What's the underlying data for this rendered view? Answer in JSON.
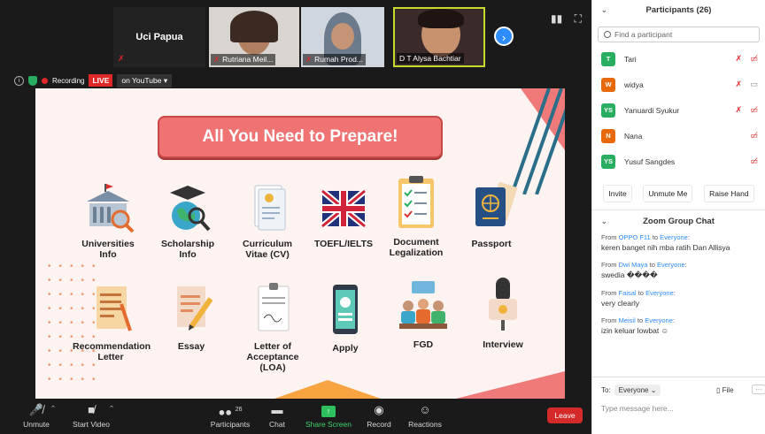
{
  "video_strip": {
    "tiles": [
      {
        "name": "Uci Papua",
        "type": "name-only"
      },
      {
        "name": "Rutriana Meil...",
        "mic": "muted"
      },
      {
        "name": "Rumah Prod...",
        "mic": "muted"
      },
      {
        "name": "D T Alysa Bachtiar",
        "mic": "on"
      }
    ]
  },
  "recording": {
    "label": "Recording",
    "live_badge": "LIVE",
    "stream": "on YouTube"
  },
  "slide": {
    "title": "All You Need to Prepare!",
    "items": [
      {
        "label1": "Universities",
        "label2": "Info",
        "icon": "university-icon"
      },
      {
        "label1": "Scholarship",
        "label2": "Info",
        "icon": "scholarship-globe-icon"
      },
      {
        "label1": "Curriculum",
        "label2": "Vitae (CV)",
        "icon": "cv-document-icon"
      },
      {
        "label1": "TOEFL/IELTS",
        "label2": "",
        "icon": "uk-flag-icon"
      },
      {
        "label1": "Document",
        "label2": "Legalization",
        "icon": "clipboard-checklist-icon"
      },
      {
        "label1": "Passport",
        "label2": "",
        "icon": "passport-icon"
      },
      {
        "label1": "Recommendation",
        "label2": "Letter",
        "icon": "recommendation-letter-icon"
      },
      {
        "label1": "Essay",
        "label2": "",
        "icon": "essay-pencil-icon"
      },
      {
        "label1": "Letter of",
        "label2": "Acceptance",
        "label3": "(LOA)",
        "icon": "loa-document-icon"
      },
      {
        "label1": "Apply",
        "label2": "",
        "icon": "phone-apply-icon"
      },
      {
        "label1": "FGD",
        "label2": "",
        "icon": "group-discussion-icon"
      },
      {
        "label1": "Interview",
        "label2": "",
        "icon": "microphone-icon"
      }
    ]
  },
  "toolbar": {
    "unmute": "Unmute",
    "start_video": "Start Video",
    "participants": "Participants",
    "participants_count": "26",
    "chat": "Chat",
    "share_screen": "Share Screen",
    "record": "Record",
    "reactions": "Reactions",
    "leave": "Leave"
  },
  "participants_panel": {
    "title": "Participants (26)",
    "search_placeholder": "Find a participant",
    "people": [
      {
        "initial": "T",
        "name": "Tari",
        "color": "#27ae60"
      },
      {
        "initial": "W",
        "name": "widya",
        "color": "#e8690c"
      },
      {
        "initial": "YS",
        "name": "Yanuardi Syukur",
        "color": "#27ae60"
      },
      {
        "initial": "N",
        "name": "Nana",
        "color": "#e8690c"
      },
      {
        "initial": "YS",
        "name": "Yusuf Sangdes",
        "color": "#27ae60"
      }
    ],
    "buttons": {
      "invite": "Invite",
      "unmute_me": "Unmute Me",
      "raise_hand": "Raise Hand"
    }
  },
  "chat_panel": {
    "title": "Zoom Group Chat",
    "messages": [
      {
        "from": "OPPO F11",
        "to": "Everyone",
        "text": "keren banget nih mba ratih Dan Allisya"
      },
      {
        "from": "Dwi Maya",
        "to": "Everyone",
        "text": "swedia ����"
      },
      {
        "from": "Faisal",
        "to": "Everyone",
        "text": "very clearly"
      },
      {
        "from": "Meisil",
        "to": "Everyone",
        "text": "izin keluar lowbat ☺"
      }
    ],
    "from_word": "From",
    "to_word": "to",
    "to_label": "To:",
    "to_value": "Everyone",
    "file": "File",
    "input_placeholder": "Type message here..."
  }
}
